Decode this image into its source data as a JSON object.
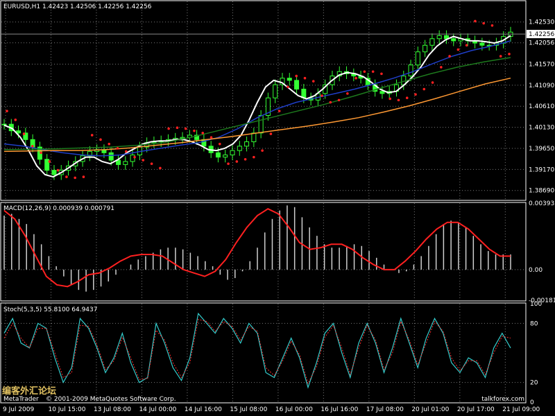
{
  "chart_data": [
    {
      "type": "candlestick",
      "title": "EURUSD,H1  1.42423 1.42506 1.42256 1.42256",
      "ylim": [
        1.3848,
        1.43
      ],
      "price_ticks": [
        "1.42530",
        "1.42056",
        "1.41570",
        "1.41090",
        "1.40610",
        "1.40130",
        "1.39650",
        "1.39170",
        "1.38690"
      ],
      "price_tick_values": [
        1.4253,
        1.42056,
        1.4157,
        1.4109,
        1.4061,
        1.4013,
        1.3965,
        1.3917,
        1.3869
      ],
      "current_price_label": "1.42256",
      "current_price": 1.42256,
      "close": [
        1.402,
        1.4005,
        1.4,
        1.3985,
        1.3968,
        1.394,
        1.3915,
        1.3905,
        1.3915,
        1.3925,
        1.3935,
        1.3948,
        1.3958,
        1.3962,
        1.3955,
        1.3938,
        1.3928,
        1.3935,
        1.395,
        1.3968,
        1.3978,
        1.398,
        1.3982,
        1.3985,
        1.3988,
        1.399,
        1.3995,
        1.3985,
        1.397,
        1.3955,
        1.3945,
        1.395,
        1.396,
        1.397,
        1.398,
        1.4,
        1.404,
        1.408,
        1.411,
        1.4125,
        1.412,
        1.41,
        1.408,
        1.4075,
        1.409,
        1.411,
        1.413,
        1.414,
        1.4135,
        1.413,
        1.4125,
        1.411,
        1.4095,
        1.409,
        1.4095,
        1.411,
        1.413,
        1.4155,
        1.4185,
        1.42,
        1.4215,
        1.4222,
        1.4215,
        1.421,
        1.4215,
        1.421,
        1.4205,
        1.42,
        1.42,
        1.4205,
        1.422,
        1.423
      ],
      "series": [
        {
          "name": "",
          "color": "#ffffff",
          "values": [
            1.4018,
            1.401,
            1.399,
            1.396,
            1.3925,
            1.3905,
            1.39,
            1.391,
            1.3922,
            1.3935,
            1.3945,
            1.3945,
            1.3935,
            1.393,
            1.394,
            1.3955,
            1.3965,
            1.3975,
            1.398,
            1.3982,
            1.3982,
            1.3985,
            1.3985,
            1.398,
            1.3972,
            1.3962,
            1.396,
            1.3965,
            1.3975,
            1.3995,
            1.403,
            1.407,
            1.4105,
            1.412,
            1.4115,
            1.41,
            1.4085,
            1.4078,
            1.4085,
            1.41,
            1.4118,
            1.4132,
            1.4138,
            1.4135,
            1.4128,
            1.4115,
            1.41,
            1.4092,
            1.4095,
            1.411,
            1.4128,
            1.415,
            1.4178,
            1.4198,
            1.4212,
            1.422,
            1.4215,
            1.421,
            1.421,
            1.4208,
            1.4205,
            1.421,
            1.4222
          ]
        },
        {
          "name": "",
          "color": "#1f3ec8",
          "values": [
            1.3975,
            1.397,
            1.3962,
            1.3955,
            1.395,
            1.3948,
            1.395,
            1.3958,
            1.3965,
            1.3972,
            1.3978,
            1.399,
            1.401,
            1.4035,
            1.4055,
            1.407,
            1.408,
            1.409,
            1.41,
            1.4112,
            1.4125,
            1.414,
            1.4158,
            1.4175,
            1.4188,
            1.4198,
            1.421
          ]
        },
        {
          "name": "",
          "color": "#1d7a1d",
          "values": [
            1.3962,
            1.3963,
            1.3964,
            1.3966,
            1.3968,
            1.3972,
            1.3978,
            1.399,
            1.4005,
            1.402,
            1.4035,
            1.405,
            1.4065,
            1.4082,
            1.41,
            1.4118,
            1.4135,
            1.415,
            1.4162,
            1.4172
          ]
        },
        {
          "name": "",
          "color": "#ff9933",
          "values": [
            1.3958,
            1.3959,
            1.396,
            1.396,
            1.3962,
            1.3966,
            1.3972,
            1.3978,
            1.3985,
            1.3992,
            1.4,
            1.4008,
            1.4016,
            1.4025,
            1.4035,
            1.4048,
            1.4062,
            1.4078,
            1.4095,
            1.4112,
            1.4125
          ]
        }
      ],
      "sar": [
        1.405,
        1.403,
        1.3998,
        1.397,
        1.3955,
        1.3935,
        1.3915,
        1.39,
        1.3898,
        1.39,
        1.3995,
        1.3985,
        1.3975,
        1.3965,
        1.3958,
        1.3945,
        1.3938,
        1.393,
        1.392,
        1.401,
        1.4012,
        1.401,
        1.4005,
        1.4,
        1.399,
        1.3975,
        1.393,
        1.3935,
        1.394,
        1.3945,
        1.396,
        1.3998,
        1.405,
        1.4105,
        1.413,
        1.4125,
        1.4118,
        1.4085,
        1.407,
        1.4075,
        1.409,
        1.4125,
        1.414,
        1.414,
        1.4135,
        1.4078,
        1.4075,
        1.408,
        1.4088,
        1.41,
        1.4115,
        1.415,
        1.4175,
        1.419,
        1.42,
        1.4255,
        1.425,
        1.4245,
        1.4175,
        1.418
      ]
    },
    {
      "type": "histogram+line",
      "title": "MACD(12,26,9) 0.000939 0.000791",
      "ylim": [
        -0.00181,
        0.003935
      ],
      "ticks": [
        "0.003935",
        "0.00",
        "-0.00181"
      ],
      "tick_values": [
        0.003935,
        0.0,
        -0.00181
      ],
      "histogram": [
        0.0032,
        0.0033,
        0.003,
        0.0027,
        0.0021,
        0.0015,
        0.0008,
        0.0002,
        -0.0004,
        -0.0009,
        -0.0012,
        -0.0013,
        -0.0012,
        -0.001,
        -0.0007,
        -0.0003,
        0.0,
        0.0003,
        0.0006,
        0.0008,
        0.001,
        0.0012,
        0.0013,
        0.0013,
        0.0012,
        0.001,
        0.0008,
        0.0005,
        0.0002,
        -0.0003,
        -0.0006,
        -0.0005,
        -0.0001,
        0.0005,
        0.0013,
        0.0022,
        0.003,
        0.0035,
        0.0038,
        0.0037,
        0.0031,
        0.0025,
        0.002,
        0.0015,
        0.0013,
        0.0013,
        0.0014,
        0.0015,
        0.0014,
        0.0011,
        0.0007,
        0.0003,
        0.0,
        -0.0002,
        -0.0001,
        0.0003,
        0.0008,
        0.0014,
        0.0021,
        0.0027,
        0.0029,
        0.0028,
        0.0025,
        0.002,
        0.0015,
        0.0011,
        0.0009,
        0.0009,
        0.0009
      ],
      "signal": [
        0.0035,
        0.003,
        0.002,
        0.0008,
        -0.0004,
        -0.0009,
        -0.001,
        -0.0007,
        -0.0003,
        -0.0002,
        0.0001,
        0.0005,
        0.0008,
        0.0009,
        0.0009,
        0.0008,
        0.0004,
        0.0,
        -0.0002,
        -0.0004,
        -0.0001,
        0.0006,
        0.0016,
        0.0025,
        0.0032,
        0.0036,
        0.0033,
        0.0025,
        0.0016,
        0.0012,
        0.0013,
        0.0015,
        0.0015,
        0.0012,
        0.0007,
        0.0003,
        0.0,
        0.0,
        0.0005,
        0.0011,
        0.0018,
        0.0024,
        0.0028,
        0.0028,
        0.0024,
        0.0018,
        0.0012,
        0.0008,
        0.0008
      ]
    },
    {
      "type": "line",
      "title": "Stoch(5,3,5) 55.8100 64.9437",
      "ylim": [
        0,
        100
      ],
      "ticks": [
        "100",
        "80",
        "20",
        "0"
      ],
      "tick_values": [
        100,
        80,
        20,
        0
      ],
      "main": [
        70,
        85,
        60,
        55,
        80,
        75,
        45,
        20,
        35,
        85,
        75,
        55,
        30,
        45,
        70,
        40,
        20,
        25,
        80,
        60,
        35,
        22,
        45,
        90,
        80,
        70,
        85,
        75,
        60,
        80,
        70,
        30,
        25,
        45,
        65,
        45,
        15,
        40,
        70,
        80,
        50,
        25,
        60,
        80,
        60,
        30,
        55,
        85,
        60,
        35,
        65,
        85,
        70,
        40,
        30,
        45,
        40,
        25,
        55,
        70,
        55
      ],
      "signal": [
        65,
        80,
        65,
        55,
        75,
        75,
        50,
        25,
        30,
        78,
        77,
        58,
        33,
        42,
        66,
        45,
        23,
        24,
        73,
        63,
        40,
        25,
        40,
        84,
        82,
        72,
        82,
        77,
        63,
        77,
        72,
        35,
        27,
        42,
        62,
        48,
        19,
        36,
        66,
        78,
        55,
        28,
        55,
        78,
        63,
        33,
        50,
        82,
        63,
        38,
        60,
        82,
        72,
        45,
        32,
        42,
        42,
        28,
        50,
        67,
        65
      ]
    }
  ],
  "time_axis": {
    "labels": [
      "9 Jul 2009",
      "10 Jul 15:00",
      "13 Jul 08:00",
      "14 Jul 00:00",
      "14 Jul 16:00",
      "15 Jul 08:00",
      "16 Jul 00:00",
      "16 Jul 16:00",
      "17 Jul 08:00",
      "20 Jul 01:00",
      "20 Jul 17:00",
      "21 Jul 09:00"
    ]
  },
  "watermark": {
    "left": "MetaTrader",
    "copyright": "© 2001-2009 MetaQuotes Software Corp.",
    "cn": "编客外汇论坛",
    "site": "talkforex.com"
  }
}
